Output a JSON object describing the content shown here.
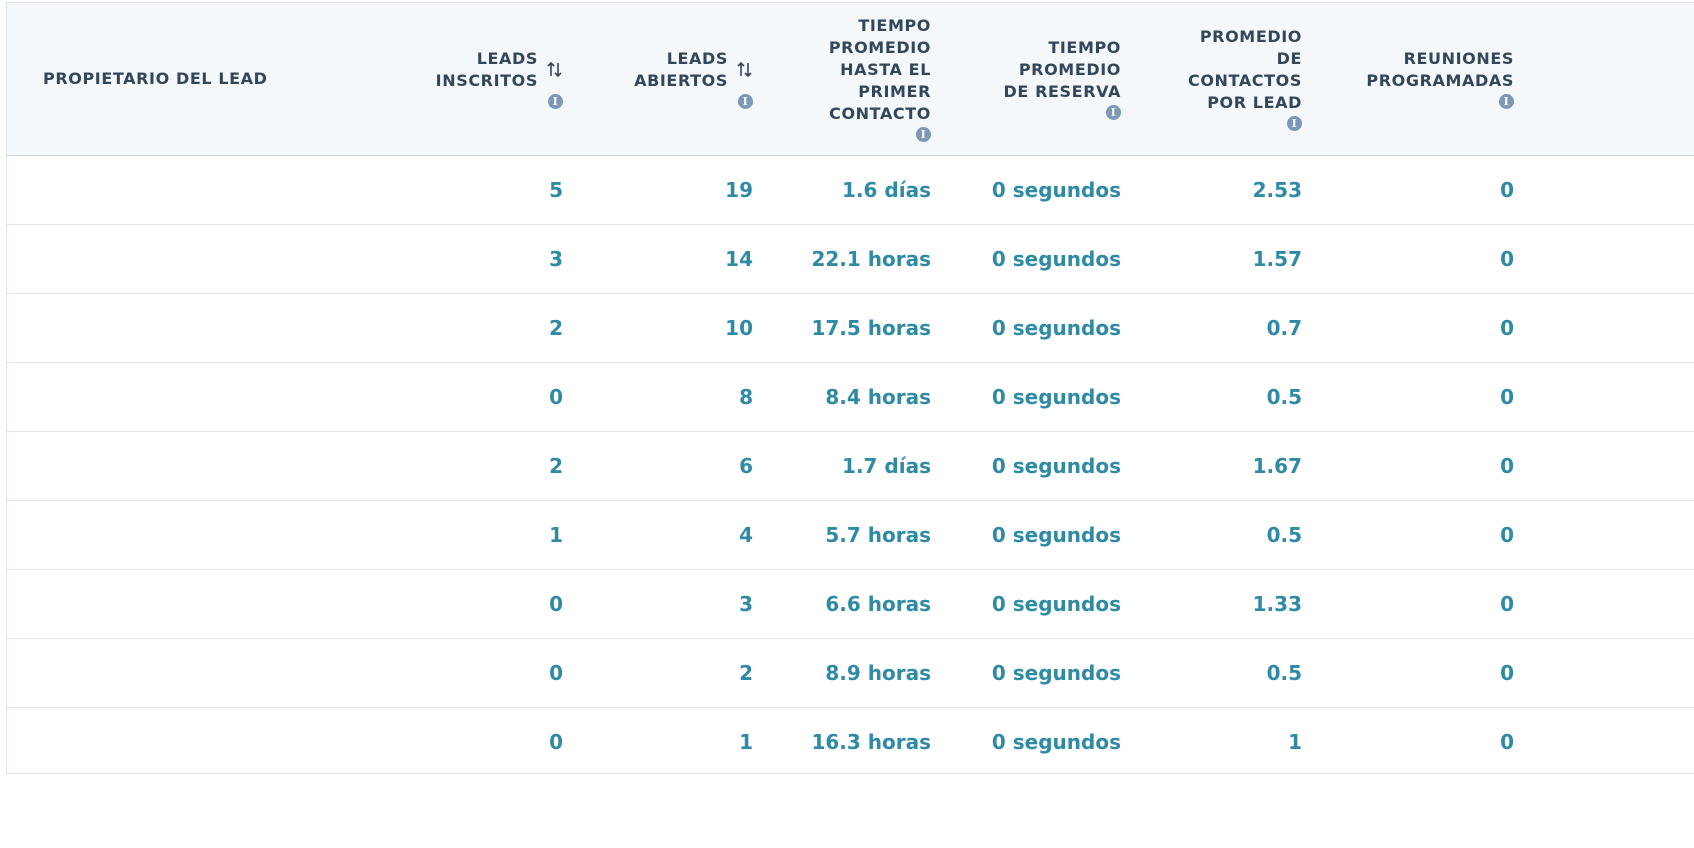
{
  "table": {
    "headers": [
      {
        "label": "PROPIETARIO DEL LEAD",
        "sortable": false,
        "info": false
      },
      {
        "label": "LEADS\nINSCRITOS",
        "sortable": true,
        "info": true
      },
      {
        "label": "LEADS\nABIERTOS",
        "sortable": true,
        "info": true
      },
      {
        "label": "TIEMPO\nPROMEDIO\nHASTA EL\nPRIMER\nCONTACTO",
        "sortable": false,
        "info": true
      },
      {
        "label": "TIEMPO\nPROMEDIO\nDE RESERVA",
        "sortable": false,
        "info": true
      },
      {
        "label": "PROMEDIO\nDE\nCONTACTOS\nPOR LEAD",
        "sortable": false,
        "info": true
      },
      {
        "label": "REUNIONES\nPROGRAMADAS",
        "sortable": false,
        "info": true
      }
    ],
    "rows": [
      [
        "",
        "5",
        "19",
        "1.6 días",
        "0 segundos",
        "2.53",
        "0"
      ],
      [
        "",
        "3",
        "14",
        "22.1 horas",
        "0 segundos",
        "1.57",
        "0"
      ],
      [
        "",
        "2",
        "10",
        "17.5 horas",
        "0 segundos",
        "0.7",
        "0"
      ],
      [
        "",
        "0",
        "8",
        "8.4 horas",
        "0 segundos",
        "0.5",
        "0"
      ],
      [
        "",
        "2",
        "6",
        "1.7 días",
        "0 segundos",
        "1.67",
        "0"
      ],
      [
        "",
        "1",
        "4",
        "5.7 horas",
        "0 segundos",
        "0.5",
        "0"
      ],
      [
        "",
        "0",
        "3",
        "6.6 horas",
        "0 segundos",
        "1.33",
        "0"
      ],
      [
        "",
        "0",
        "2",
        "8.9 horas",
        "0 segundos",
        "0.5",
        "0"
      ],
      [
        "",
        "0",
        "1",
        "16.3 horas",
        "0 segundos",
        "1",
        "0"
      ]
    ]
  },
  "icons": {
    "info": "i"
  },
  "colors": {
    "value": "#2f8aa5",
    "header_text": "#33475b",
    "header_bg": "#f5f8fa",
    "info_icon": "#7c98b6"
  }
}
